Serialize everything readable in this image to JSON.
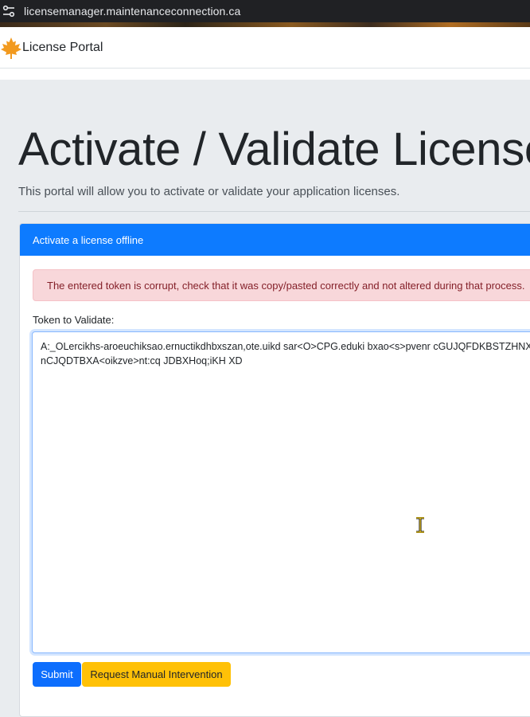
{
  "browser": {
    "url": "licensemanager.maintenanceconnection.ca",
    "site_info_icon": "tune-icon"
  },
  "navbar": {
    "brand": "License Portal",
    "logo_icon": "maple-leaf-icon"
  },
  "page": {
    "title": "Activate / Validate License",
    "lead": "This portal will allow you to activate or validate your application licenses."
  },
  "card": {
    "header": "Activate a license offline",
    "alert": "The entered token is corrupt, check that it was copy/pasted correctly and not altered during that process.",
    "field_label": "Token to Validate:",
    "token_value": "A:_OLercikhs-aroeuchiksao.ernuctikdhbxszan,ote.uikd sar<O>CPG.eduki bxao<s>pvenr cGUJQFDKBSTZHNX nCJQDTBXA<oikzve>nt:cq JDBXHoq;iKH XD"
  },
  "actions": {
    "submit_label": "Submit",
    "manual_label": "Request Manual Intervention"
  },
  "colors": {
    "card_header": "#0d7bff",
    "alert_bg": "#f8d7da",
    "alert_text": "#842029",
    "submit_bg": "#0d6efd",
    "manual_bg": "#ffc107"
  }
}
